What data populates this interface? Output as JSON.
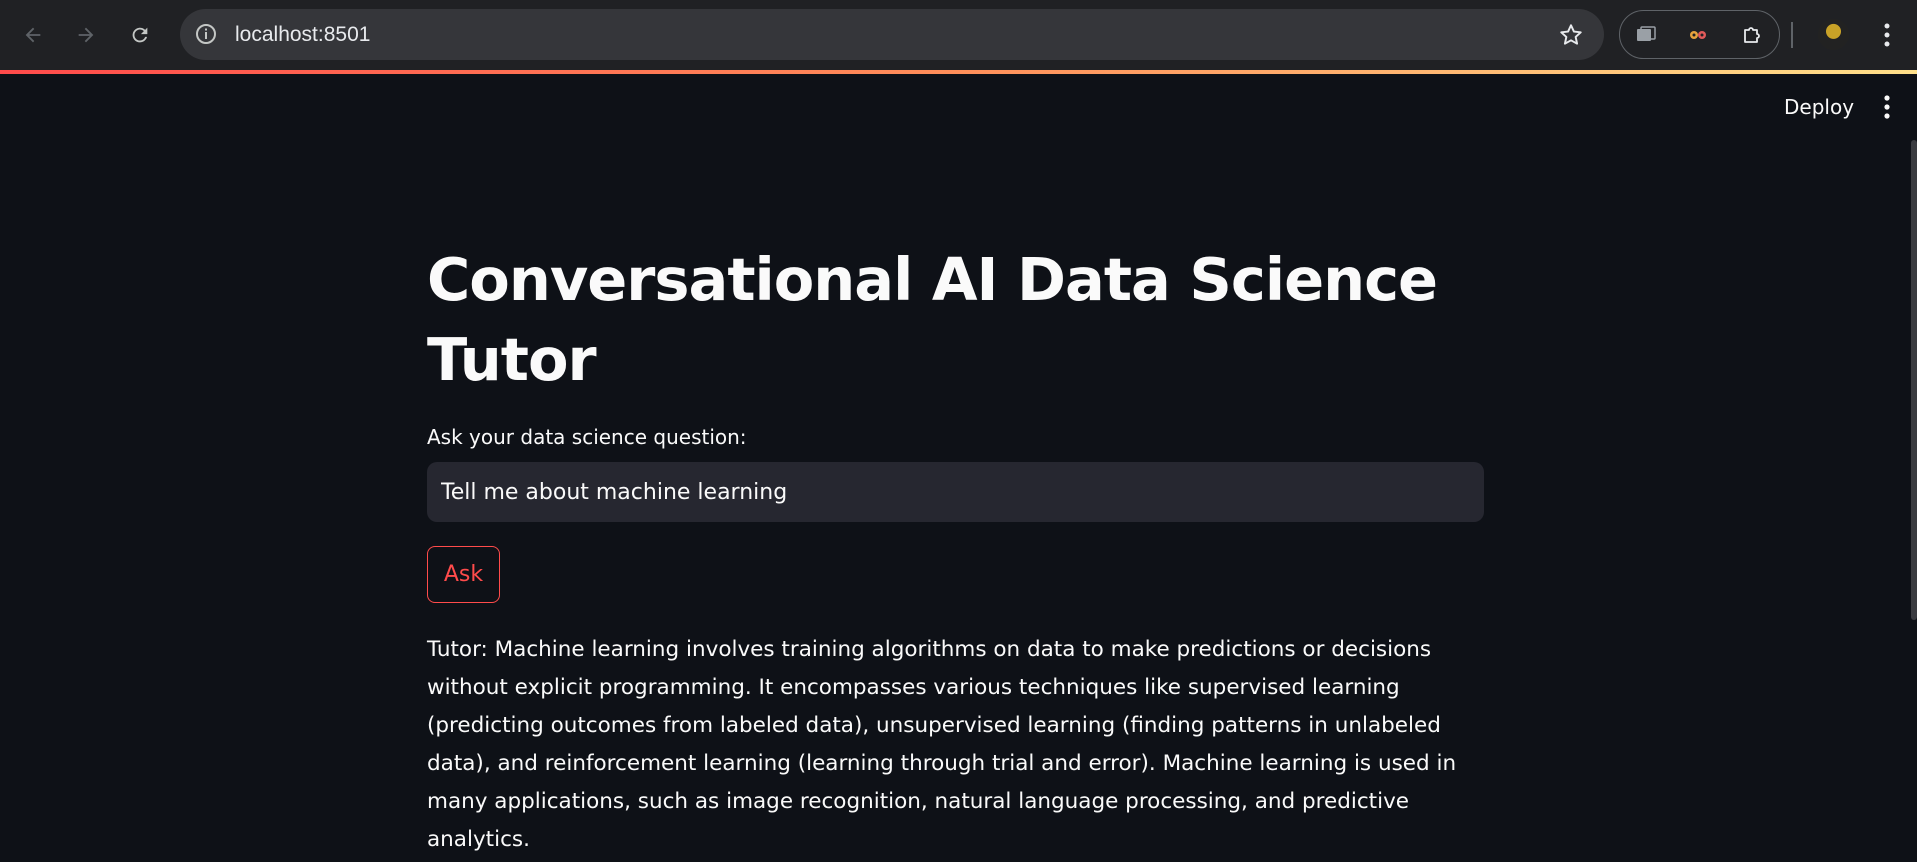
{
  "browser": {
    "url": "localhost:8501",
    "icons": [
      "back-arrow-icon",
      "forward-arrow-icon",
      "reload-icon",
      "info-icon",
      "bookmark-star-icon",
      "extension-tab-icon",
      "extension-eyes-icon",
      "extensions-puzzle-icon",
      "profile-avatar",
      "more-vertical-icon"
    ]
  },
  "app_header": {
    "deploy_label": "Deploy",
    "accent_gradient": [
      "#ff4b4b",
      "#ffe08a"
    ]
  },
  "main": {
    "title": "Conversational AI Data Science Tutor",
    "question_label": "Ask your data science question:",
    "question_value": "Tell me about machine learning",
    "ask_label": "Ask",
    "answer": "Tutor: Machine learning involves training algorithms on data to make predictions or decisions without explicit programming. It encompasses various techniques like supervised learning (predicting outcomes from labeled data), unsupervised learning (finding patterns in unlabeled data), and reinforcement learning (learning through trial and error). Machine learning is used in many applications, such as image recognition, natural language processing, and predictive analytics."
  },
  "colors": {
    "background": "#0e1117",
    "input_bg": "#262730",
    "accent": "#ff4b4b",
    "text": "#fafafa"
  }
}
